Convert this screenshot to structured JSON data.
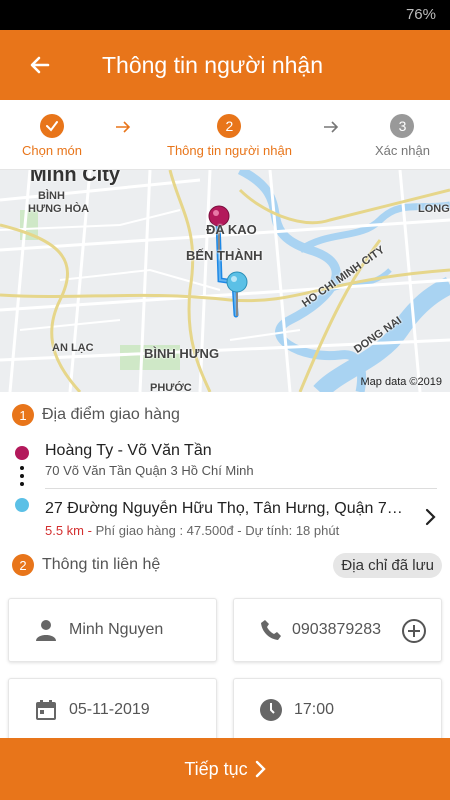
{
  "status_bar": {
    "battery": "76%"
  },
  "header": {
    "title": "Thông tin người nhận",
    "back_icon": "back-arrow-icon"
  },
  "steps": [
    {
      "number": "",
      "label": "Chọn món",
      "state": "done"
    },
    {
      "number": "2",
      "label": "Thông tin người nhận",
      "state": "active"
    },
    {
      "number": "3",
      "label": "Xác nhận",
      "state": "pending"
    }
  ],
  "map": {
    "labels": {
      "city": "Minh City",
      "binh_hung_hoa_1": "BÌNH",
      "binh_hung_hoa_2": "HƯNG HÒA",
      "da_kao": "ĐA KAO",
      "ben_thanh": "BẾN THÀNH",
      "an_lac": "AN LẠC",
      "binh_hung": "BÌNH HƯNG",
      "long": "LONG",
      "ho_chi_minh_city": "HO CHI MINH CITY",
      "dong_nai": "DONG NAI",
      "phuoc": "PHƯỚC"
    },
    "credit": "Map data ©2019"
  },
  "delivery": {
    "badge": "1",
    "title": "Địa điểm giao hàng",
    "from_name": "Hoàng Ty - Võ Văn Tần",
    "from_address": "70 Võ Văn Tần Quận 3 Hồ Chí Minh",
    "to_address": "27 Đường Nguyễn Hữu Thọ, Tân Hưng, Quận 7, ...",
    "distance": "5.5 km -",
    "fee_info": "Phí giao hàng : 47.500đ - Dự tính: 18 phút"
  },
  "contact": {
    "badge": "2",
    "title": "Thông tin liên hệ",
    "saved_address_label": "Địa chỉ đã lưu",
    "name": "Minh Nguyen",
    "phone": "0903879283",
    "date": "05-11-2019",
    "time": "17:00"
  },
  "footer": {
    "continue_label": "Tiếp tục"
  },
  "colors": {
    "primary": "#e8751a",
    "pink_marker": "#b3195b",
    "blue_marker": "#5bc0e6",
    "distance_red": "#d32f2f"
  }
}
